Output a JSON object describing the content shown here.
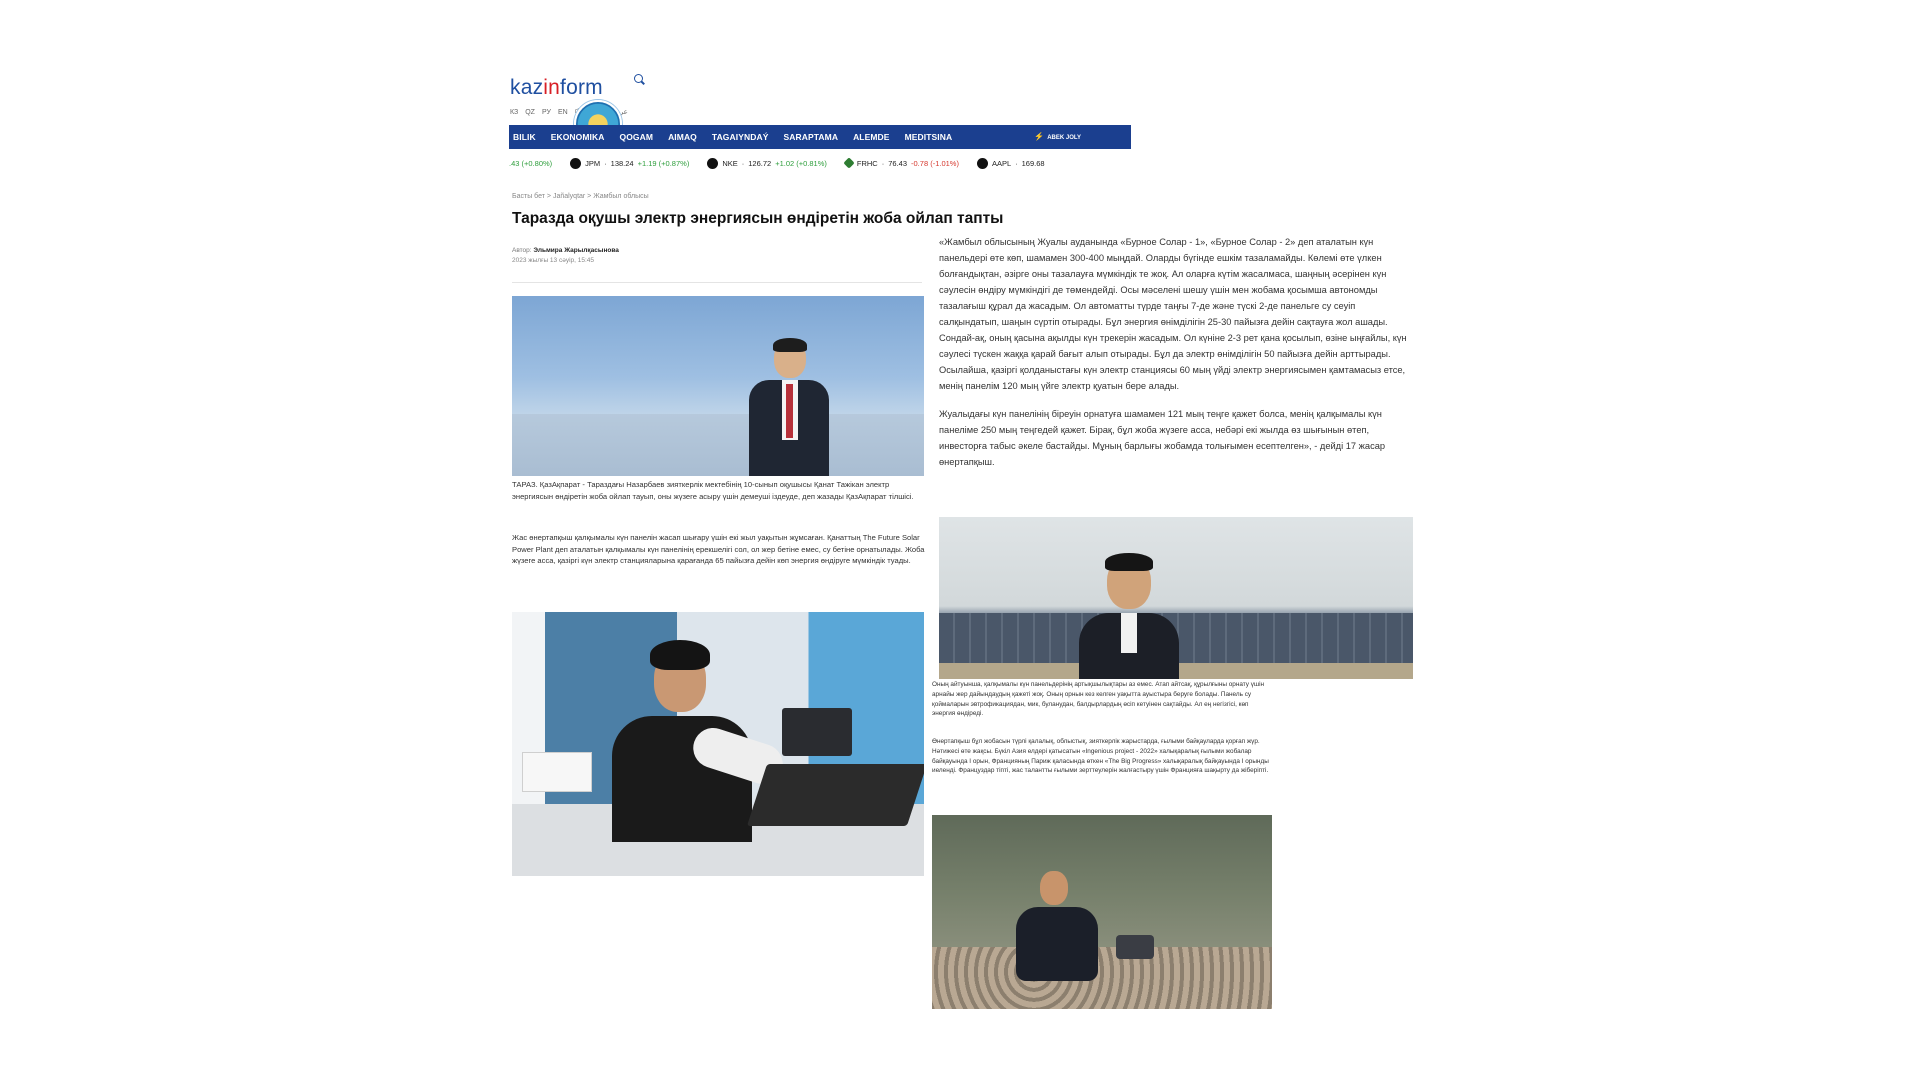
{
  "site": {
    "logo_part1": "kaz",
    "logo_accent": "in",
    "logo_part2": "form",
    "languages": [
      "КЗ",
      "QZ",
      "РУ",
      "EN",
      "中文",
      "TR",
      "عربي"
    ],
    "nav": [
      "BILIK",
      "EKONOMIKA",
      "QOGAM",
      "AIMAQ",
      "TAGAIYNDAÝ",
      "SARAPTAMA",
      "ALEMDE",
      "MEDITSINA"
    ],
    "nav_right": "ABEK JOLY",
    "colors": {
      "brand_blue": "#1b3f8f",
      "logo_red": "#d81f26",
      "up": "#2e9e3c",
      "down": "#d6392f"
    }
  },
  "ticker": {
    "first": ".43 (+0.80%)",
    "items": [
      {
        "symbol": "JPM",
        "price": "138.24",
        "change": "+1.19 (+0.87%)",
        "dir": "up"
      },
      {
        "symbol": "NKE",
        "price": "126.72",
        "change": "+1.02 (+0.81%)",
        "dir": "up"
      },
      {
        "symbol": "FRHC",
        "price": "76.43",
        "change": "-0.78 (-1.01%)",
        "dir": "down"
      },
      {
        "symbol": "AAPL",
        "price": "169.68",
        "change": "",
        "dir": ""
      }
    ]
  },
  "article": {
    "breadcrumb": "Басты бет  >  Jañalyqtar  >  Жамбыл облысы",
    "headline": "Таразда оқушы электр энергиясын өндіретін жоба ойлап тапты",
    "author_label": "Автор:",
    "author": "Эльмира Жарылқасынова",
    "date": "2023 жылғы 13 сәуір, 15:45",
    "caption": "ТАРАЗ. ҚазАқпарат - Тараздағы Назарбаев зияткерлік мектебінің 10-сынып оқушысы Қанат Тажікан электр энергиясын өндіретін жоба ойлап тауып, оны жүзеге асыру үшін демеуші іздеуде, деп жазады ҚазАқпарат тілшісі.",
    "paragraph1": "Жас өнертапқыш қалқымалы күн панелін жасап шығару үшін екі жыл уақытын жұмсаған. Қанаттың The Future Solar Power Plant деп аталатын қалқымалы күн панелінің ерекшелігі сол, ол жер бетіне емес, су бетіне орнатылады. Жоба жүзеге асса, қазіргі күн электр станцияларына қарағанда 65 пайызға дейін көп энергия өндіруге мүмкіндік туады.",
    "right_paragraph1": "«Жамбыл облысының Жуалы ауданында «Бурное Солар - 1», «Бурное Солар - 2» деп аталатын күн панельдері өте көп, шамамен 300-400 мыңдай. Оларды бүгінде ешкім тазаламайды. Көлемі өте үлкен болғандықтан, әзірге оны тазалауға мүмкіндік те жоқ. Ал оларға күтім жасалмаса, шаңның әсерінен күн сәулесін өндіру мүмкіндігі де төмендейді. Осы мәселені шешу үшін мен жобама қосымша автономды тазалағыш құрал да жасадым. Ол автоматты түрде таңғы 7-де және түскі 2-де панельге су сеуіп салқындатып, шаңын сүртіп отырады. Бұл энергия өнімділігін 25-30 пайызға дейін сақтауға жол ашады. Сондай-ақ, оның қасына ақылды күн трекерін жасадым. Ол күніне 2-3 рет қана қосылып, өзіне ыңғайлы, күн сәулесі түскен жаққа қарай бағыт алып отырады. Бұл да электр өнімділігін 50 пайызға дейін арттырады. Осылайша, қазіргі қолданыстағы күн электр станциясы 60 мың үйді электр энергиясымен қамтамасыз етсе, менің панелім 120 мың үйге электр қуатын бере алады.",
    "right_paragraph2": "Жуалыдағы күн панелінің біреуін орнатуға шамамен 121 мың теңге қажет болса, менің қалқымалы күн панеліме 250 мың теңгедей қажет. Бірақ, бұл жоба жүзеге асса, небәрі екі жылда өз шығынын өтеп, инвесторға табыс әкеле бастайды. Мұның барлығы жобамда толығымен есептелген», - дейді 17 жасар өнертапқыш.",
    "small_paragraph1": "Оның айтуынша, қалқымалы күн панельдерінің артықшылықтары аз емес. Атап айтсақ, құрылғыны орнату үшін арнайы жер дайындаудың қажеті жоқ. Оның орнын кез келген уақытта ауыстыра беруге болады. Панель су қоймаларын эвтрофикациядан, мик, буланудан, балдырлардың өсіп кетуінен сақтайды. Ал ең негізгісі, көп энергия өндіреді.",
    "small_paragraph2": "Өнертапқыш бұл жобасын түрлі қалалық, облыстық, зияткерлік жарыстарда, ғылыми байқауларда қорғап жүр. Нәтижесі өте жақсы. Бүкіл Азия елдері қатысатын «Ingenious project - 2022» халықаралық ғылыми жобалар байқауында I орын, Францияның Париж қаласында өткен «The Big Progress» халықаралық байқауында I орынды иеленді. Француздар тіпті, жас талантты ғылыми зерттеулерін жалғастыру үшін Францияға шақырту да жіберіпті."
  }
}
